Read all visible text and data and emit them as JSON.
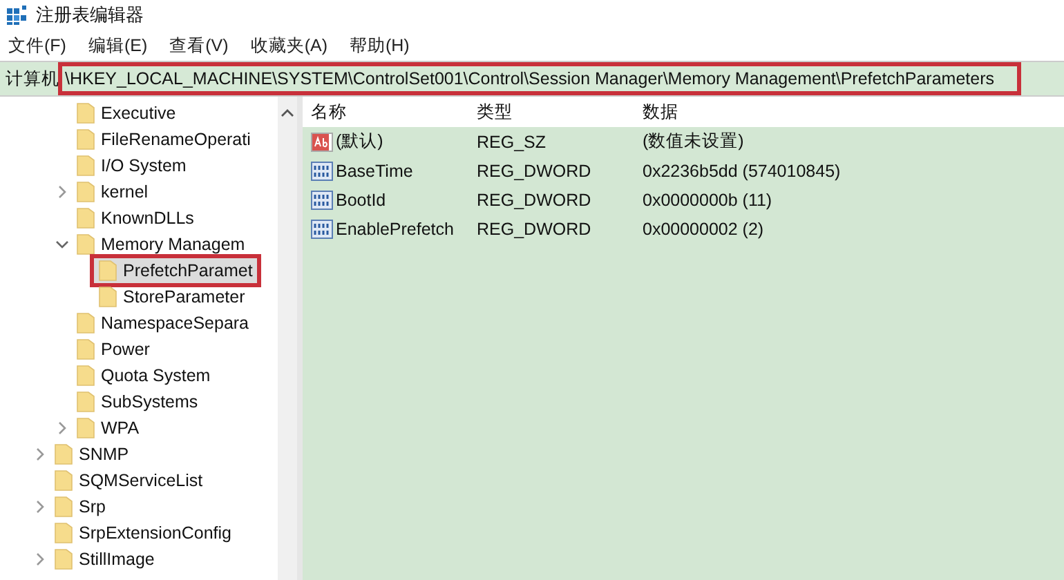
{
  "window": {
    "title": "注册表编辑器"
  },
  "menu": [
    "文件(F)",
    "编辑(E)",
    "查看(V)",
    "收藏夹(A)",
    "帮助(H)"
  ],
  "address_bar": {
    "label": "计算机",
    "path": "\\HKEY_LOCAL_MACHINE\\SYSTEM\\ControlSet001\\Control\\Session Manager\\Memory Management\\PrefetchParameters",
    "highlighted": true
  },
  "tree": {
    "continued_children": [
      {
        "label": "Executive",
        "selected": false,
        "highlighted": false
      },
      {
        "label": "FileRenameOperati",
        "selected": false,
        "highlighted": false
      },
      {
        "label": "I/O System",
        "selected": false,
        "highlighted": false
      },
      {
        "label": "kernel",
        "expanded": false,
        "selected": false,
        "highlighted": false
      },
      {
        "label": "KnownDLLs",
        "selected": false,
        "highlighted": false
      },
      {
        "label": "Memory Managem",
        "expanded": true,
        "selected": false,
        "highlighted": false,
        "children": [
          {
            "label": "PrefetchParamet",
            "selected": true,
            "highlighted": true
          },
          {
            "label": "StoreParameter",
            "selected": false,
            "highlighted": false
          }
        ]
      },
      {
        "label": "NamespaceSepara",
        "selected": false,
        "highlighted": false
      },
      {
        "label": "Power",
        "selected": false,
        "highlighted": false
      },
      {
        "label": "Quota System",
        "selected": false,
        "highlighted": false
      },
      {
        "label": "SubSystems",
        "selected": false,
        "highlighted": false
      },
      {
        "label": "WPA",
        "expanded": false,
        "selected": false,
        "highlighted": false
      }
    ],
    "items": [
      {
        "label": "SNMP",
        "expanded": false,
        "selected": false,
        "highlighted": false
      },
      {
        "label": "SQMServiceList",
        "selected": false,
        "highlighted": false
      },
      {
        "label": "Srp",
        "expanded": false,
        "selected": false,
        "highlighted": false
      },
      {
        "label": "SrpExtensionConfig",
        "selected": false,
        "highlighted": false
      },
      {
        "label": "StillImage",
        "expanded": false,
        "selected": false,
        "highlighted": false
      }
    ]
  },
  "table": {
    "columns": [
      "名称",
      "类型",
      "数据"
    ],
    "rows": [
      {
        "kind": "string",
        "name": "(默认)",
        "type": "REG_SZ",
        "data": "(数值未设置)"
      },
      {
        "kind": "binary",
        "name": "BaseTime",
        "type": "REG_DWORD",
        "data": "0x2236b5dd (574010845)"
      },
      {
        "kind": "binary",
        "name": "BootId",
        "type": "REG_DWORD",
        "data": "0x0000000b (11)"
      },
      {
        "kind": "binary",
        "name": "EnablePrefetch",
        "type": "REG_DWORD",
        "data": "0x00000002 (2)"
      }
    ]
  }
}
